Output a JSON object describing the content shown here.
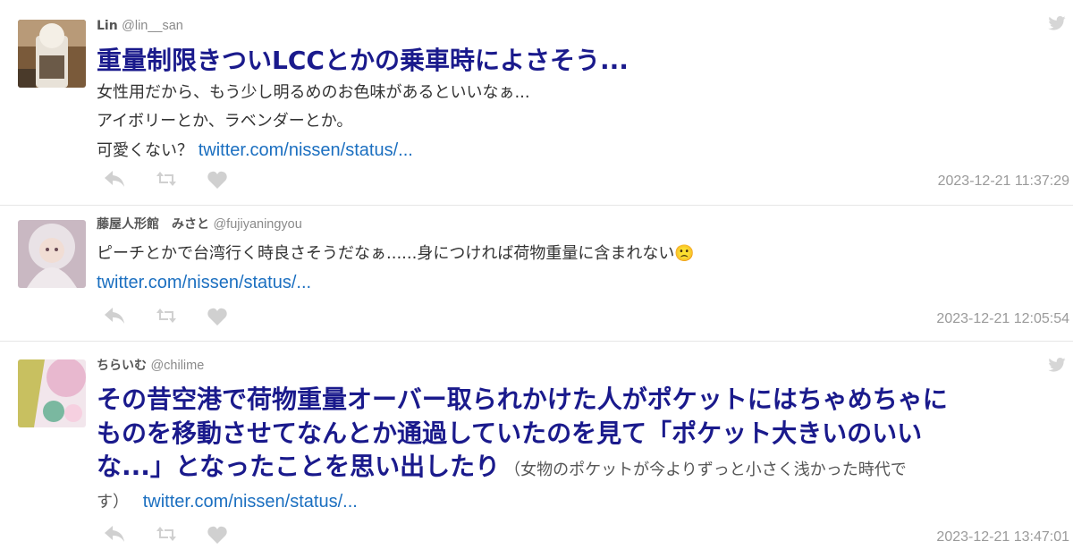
{
  "tweets": [
    {
      "user_name": "Lin",
      "handle": "@lin__san",
      "headline": "重量制限きついLCCとかの乗車時によさそう...",
      "lines": [
        "女性用だから、もう少し明るめのお色味があるといいなぁ...",
        "アイボリーとか、ラベンダーとか。",
        "可愛くない？"
      ],
      "link": "twitter.com/nissen/status/...",
      "timestamp": "2023-12-21 11:37:29"
    },
    {
      "user_name": "藤屋人形館　みさと",
      "handle": "@fujiyaningyou",
      "text": "ピーチとかで台湾行く時良さそうだなぁ......身につければ荷物重量に含まれない",
      "emoji": "🙁",
      "link": "twitter.com/nissen/status/...",
      "timestamp": "2023-12-21 12:05:54"
    },
    {
      "user_name": "ちらいむ",
      "handle": "@chilime",
      "headline_lines": [
        "その昔空港で荷物重量オーバー取られかけた人がポケットにはちゃめちゃに",
        "ものを移動させてなんとか通過していたのを見て「ポケット大きいのいい",
        "な...」となったことを思い出したり"
      ],
      "aside": "（女物のポケットが今よりずっと小さく浅かった時代で",
      "aside_cont": "す）",
      "link": "twitter.com/nissen/status/...",
      "timestamp": "2023-12-21 13:47:01"
    }
  ],
  "icons": {
    "reply": "reply-icon",
    "retweet": "retweet-icon",
    "like": "heart-icon",
    "bird": "twitter-bird-icon"
  },
  "colors": {
    "headline": "#1a1a8c",
    "link": "#1b6fc0",
    "icon": "#d0d0d0",
    "timestamp": "#9a9a9a"
  }
}
